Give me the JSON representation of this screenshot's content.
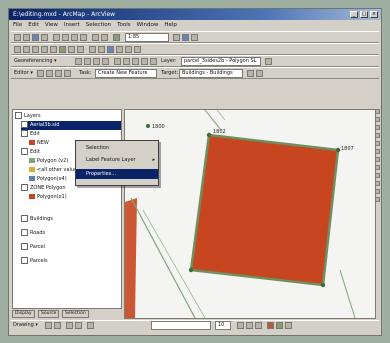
{
  "window": {
    "title": "E:\\editing.mxd - ArcMap - ArcView",
    "minimize": "_",
    "maximize": "□",
    "close": "×"
  },
  "menu": [
    "File",
    "Edit",
    "View",
    "Insert",
    "Selection",
    "Tools",
    "Window",
    "Help"
  ],
  "toolbar1": {
    "scale_value": "1:85"
  },
  "toolbar3": {
    "georef_label": "Georeferencing ▾",
    "layer_label": "Layer:",
    "layer_value": "parcel_3sides2b - Polygon SL"
  },
  "toolbar4": {
    "editor_label": "Editor ▾",
    "task_label": "Task:",
    "task_value": "Create New Feature",
    "target_label": "Target:",
    "target_value": "Buildings - Buildings"
  },
  "toc": {
    "items": [
      {
        "label": "Layers",
        "indent": 0,
        "type": "group"
      },
      {
        "label": "Aerial3b.sid",
        "indent": 1,
        "type": "layer",
        "selected": true
      },
      {
        "label": "Edit",
        "indent": 1,
        "type": "layer"
      },
      {
        "label": "NEW",
        "indent": 2,
        "type": "layer"
      },
      {
        "label": "Edit",
        "indent": 1,
        "type": "layer"
      },
      {
        "label": "Polygon (v2)",
        "indent": 2,
        "type": "layer"
      },
      {
        "label": "<all other values>",
        "indent": 2,
        "type": "legend"
      },
      {
        "label": "Polygon(x4)",
        "indent": 2,
        "type": "legend"
      },
      {
        "label": "ZONE Polygon",
        "indent": 1,
        "type": "layer"
      },
      {
        "label": "Polygon(x1)",
        "indent": 2,
        "type": "legend"
      },
      {
        "label": "Buildings",
        "indent": 0,
        "type": "layer"
      },
      {
        "label": "Roads",
        "indent": 0,
        "type": "layer"
      },
      {
        "label": "Parcel",
        "indent": 0,
        "type": "layer"
      },
      {
        "label": "Parcels",
        "indent": 0,
        "type": "layer"
      }
    ]
  },
  "context_menu": {
    "items": [
      {
        "label": "Selection",
        "submenu": false
      },
      {
        "label": "Label Feature Layer",
        "submenu": true
      },
      {
        "label": "Properties...",
        "submenu": false,
        "highlighted": true
      }
    ]
  },
  "map": {
    "parcel_fill": "#c8461f",
    "parcel_outline": "#6f8f5f",
    "road_line": "#7fa67d",
    "vertex_labels": [
      "1800",
      "1802",
      "1807"
    ]
  },
  "tabs": [
    "Display",
    "Source",
    "Selection"
  ],
  "drawing": {
    "drawing_label": "Drawing ▾",
    "font_size": "10"
  }
}
